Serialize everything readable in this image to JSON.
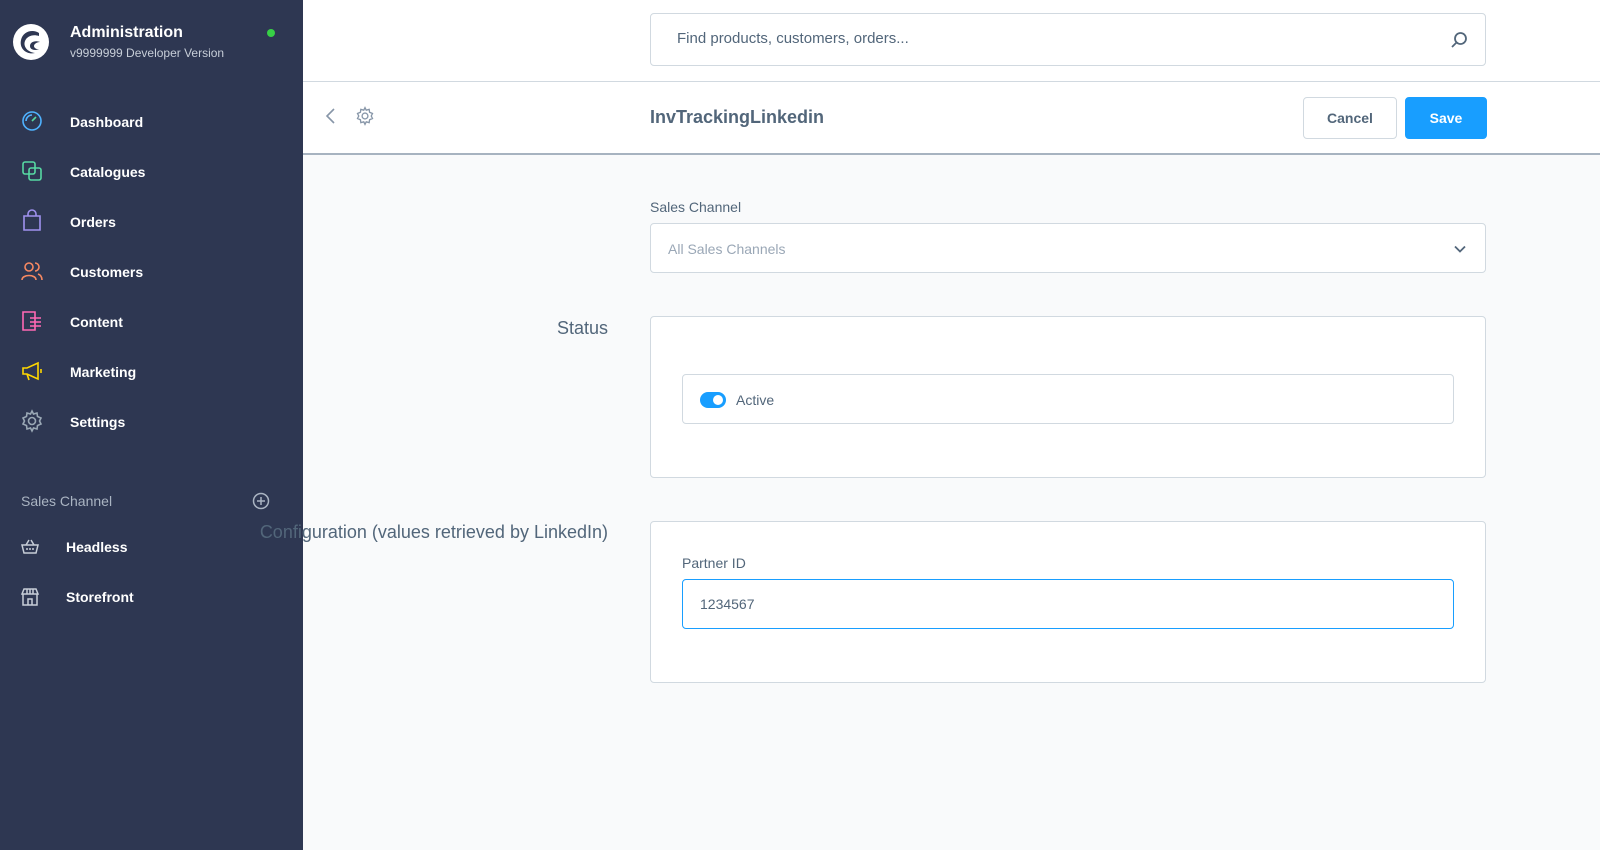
{
  "brand": {
    "title": "Administration",
    "version": "v9999999 Developer Version",
    "status_color": "#37d046"
  },
  "sidebar": {
    "items": [
      {
        "label": "Dashboard",
        "icon": "dashboard-icon",
        "color": "#57d9a3"
      },
      {
        "label": "Catalogues",
        "icon": "catalogues-icon",
        "color": "#57d9a3"
      },
      {
        "label": "Orders",
        "icon": "orders-icon",
        "color": "#a092f0"
      },
      {
        "label": "Customers",
        "icon": "customers-icon",
        "color": "#f88962"
      },
      {
        "label": "Content",
        "icon": "content-icon",
        "color": "#ff68b4"
      },
      {
        "label": "Marketing",
        "icon": "marketing-icon",
        "color": "#ffd700"
      },
      {
        "label": "Settings",
        "icon": "settings-icon",
        "color": "#9aa8b5"
      }
    ],
    "sales_channel_header": "Sales Channel",
    "sales_channels": [
      {
        "label": "Headless",
        "icon": "basket-icon"
      },
      {
        "label": "Storefront",
        "icon": "storefront-icon"
      }
    ]
  },
  "search": {
    "placeholder": "Find products, customers, orders..."
  },
  "smartbar": {
    "title": "InvTrackingLinkedin",
    "cancel_label": "Cancel",
    "save_label": "Save"
  },
  "form": {
    "sales_channel_label": "Sales Channel",
    "sales_channel_value": "All Sales Channels",
    "status_section": "Status",
    "active_label": "Active",
    "active": true,
    "config_section": "Configuration (values retrieved by LinkedIn)",
    "partner_id_label": "Partner ID",
    "partner_id_value": "1234567"
  },
  "colors": {
    "sidebar_bg": "#2e3752",
    "accent": "#189eff"
  }
}
